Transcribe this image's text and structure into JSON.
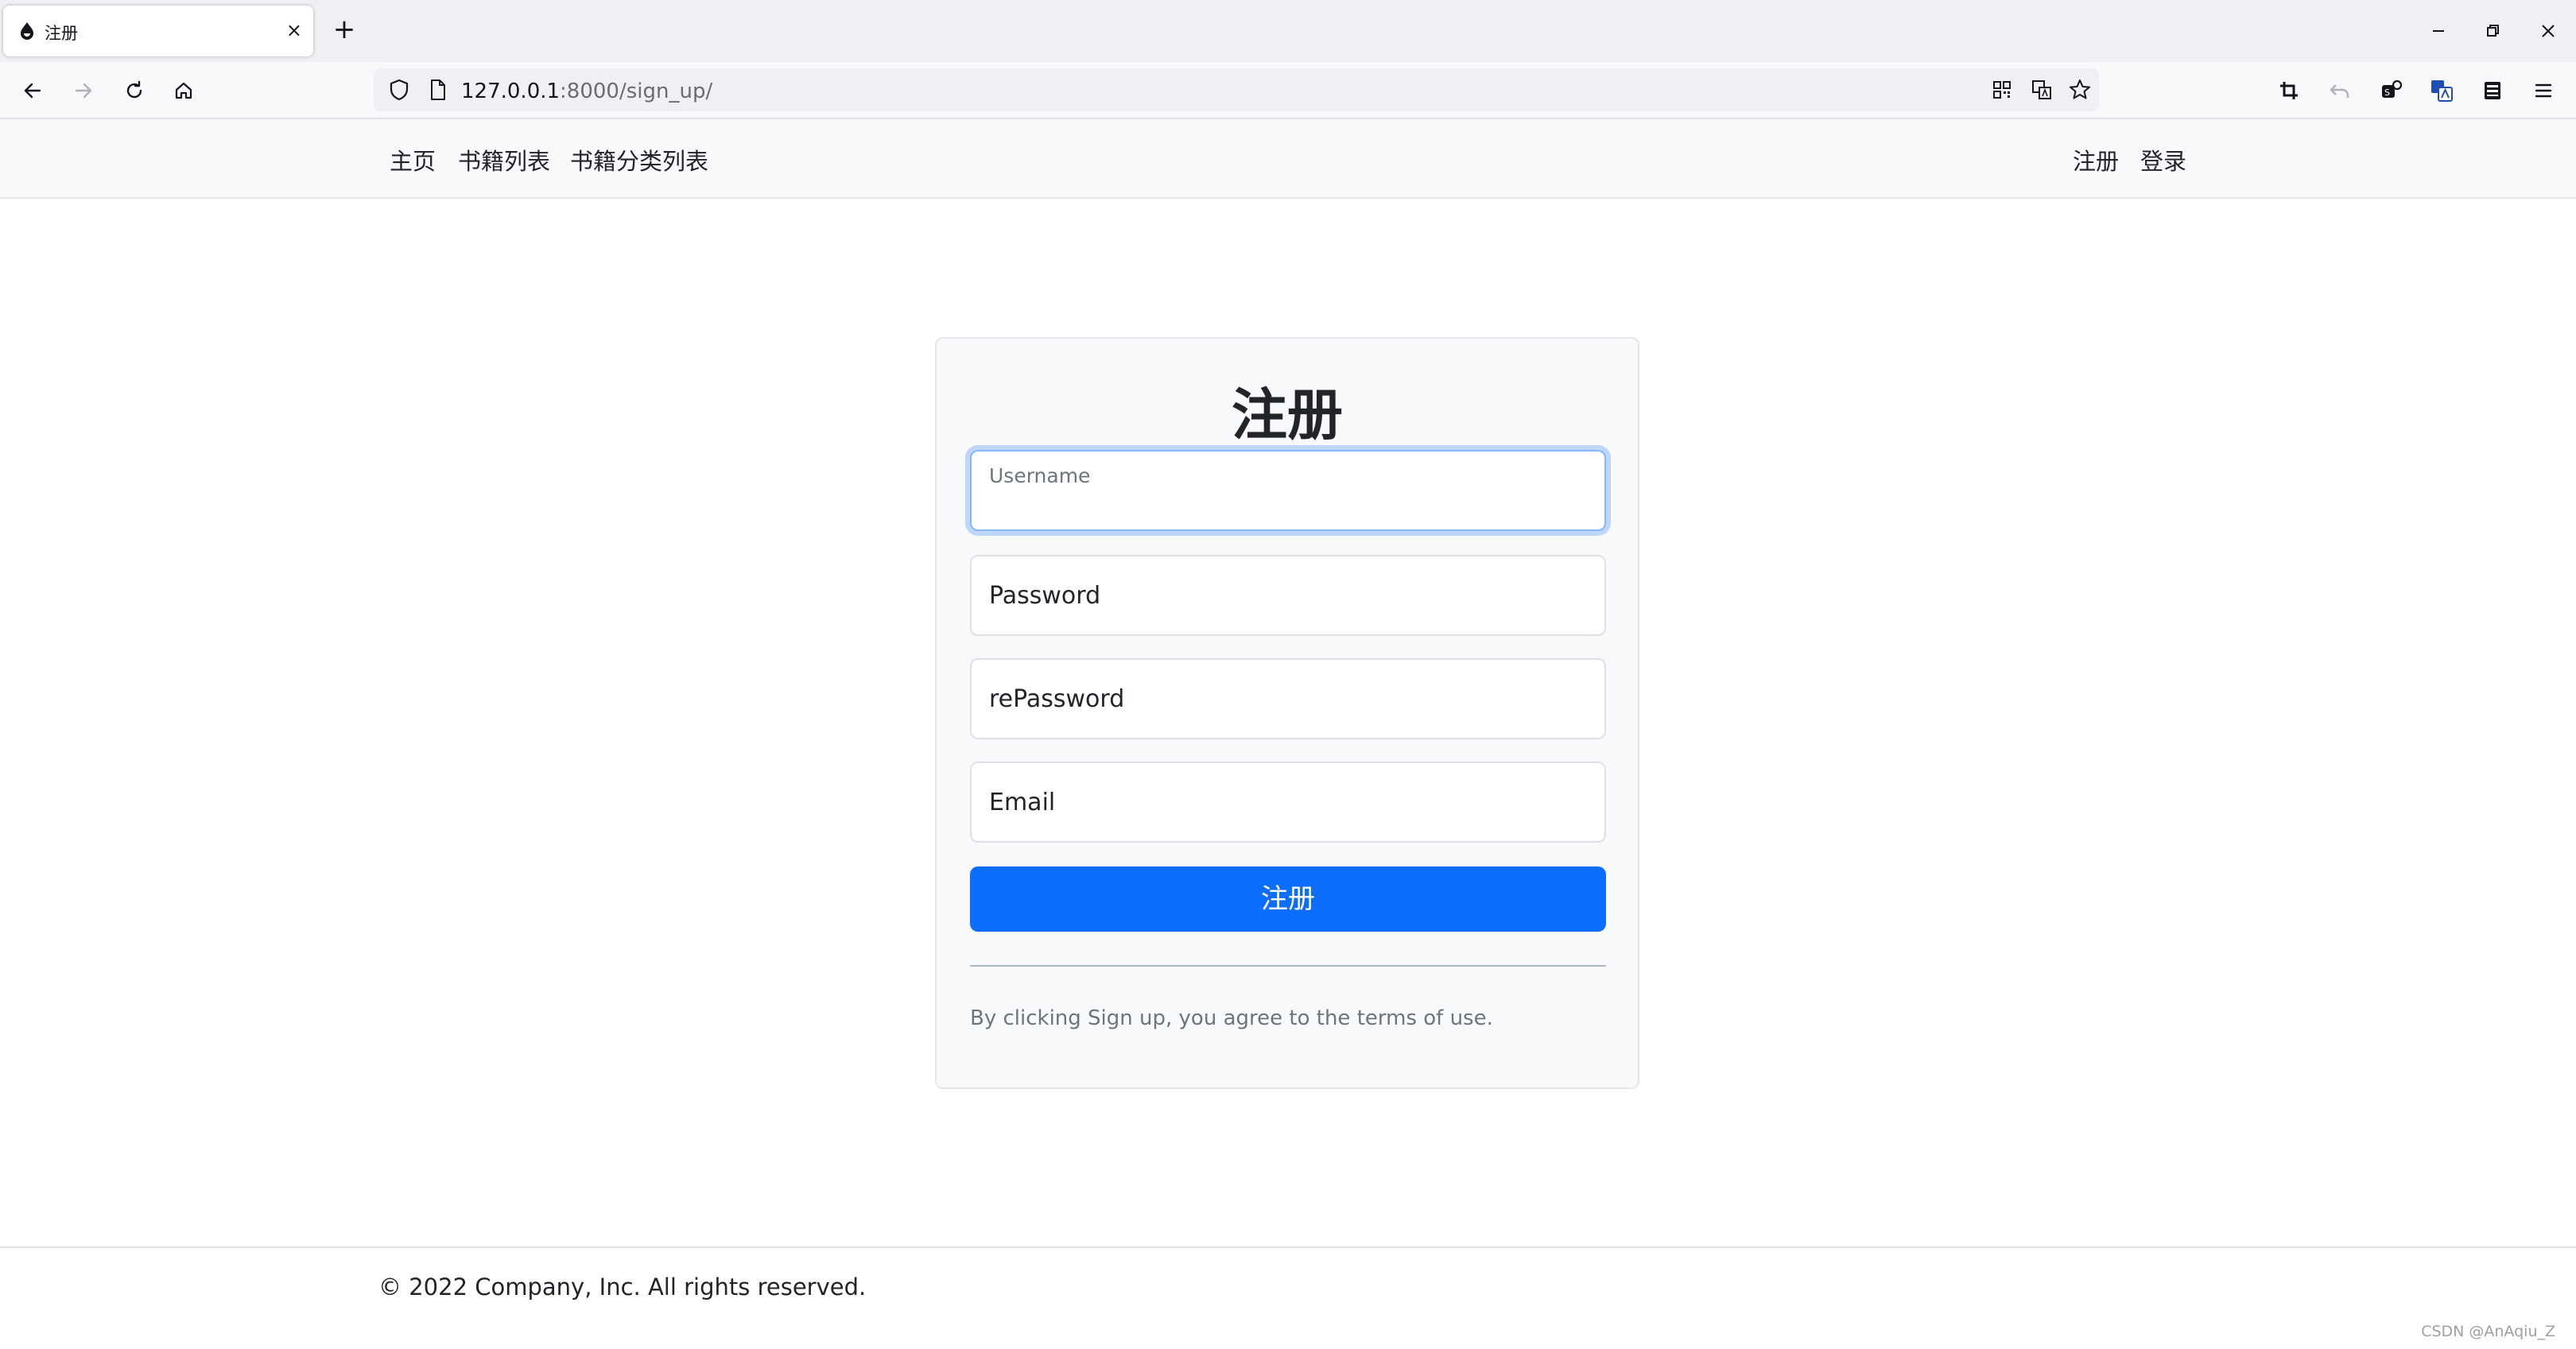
{
  "browser": {
    "tab": {
      "title": "注册",
      "favicon": "flame-drop-icon",
      "close": "×"
    },
    "new_tab": "+",
    "url": {
      "host": "127.0.0.1",
      "rest": ":8000/sign_up/"
    },
    "icons": [
      "back-icon",
      "forward-icon",
      "reload-icon",
      "home-icon",
      "shield-icon",
      "page-icon",
      "qr-code-icon",
      "translate-icon",
      "bookmark-star-icon",
      "crop-icon",
      "undo-icon",
      "extension-icon",
      "translator-icon",
      "library-icon",
      "menu-icon",
      "minimize-icon",
      "restore-icon",
      "close-icon"
    ]
  },
  "nav": {
    "left": [
      "主页",
      "书籍列表",
      "书籍分类列表"
    ],
    "right": [
      "注册",
      "登录"
    ]
  },
  "form": {
    "title": "注册",
    "username_label": "Username",
    "password_label": "Password",
    "repassword_label": "rePassword",
    "email_label": "Email",
    "submit_label": "注册",
    "terms": "By clicking Sign up, you agree to the terms of use."
  },
  "footer": {
    "copyright": "© 2022 Company, Inc. All rights reserved."
  },
  "watermark": "CSDN @AnAqiu_Z",
  "colors": {
    "primary": "#0d6efd",
    "navbar_bg": "#f8f9fa",
    "card_bg": "#f8f9fa",
    "focus_ring": "#86b7fe"
  }
}
